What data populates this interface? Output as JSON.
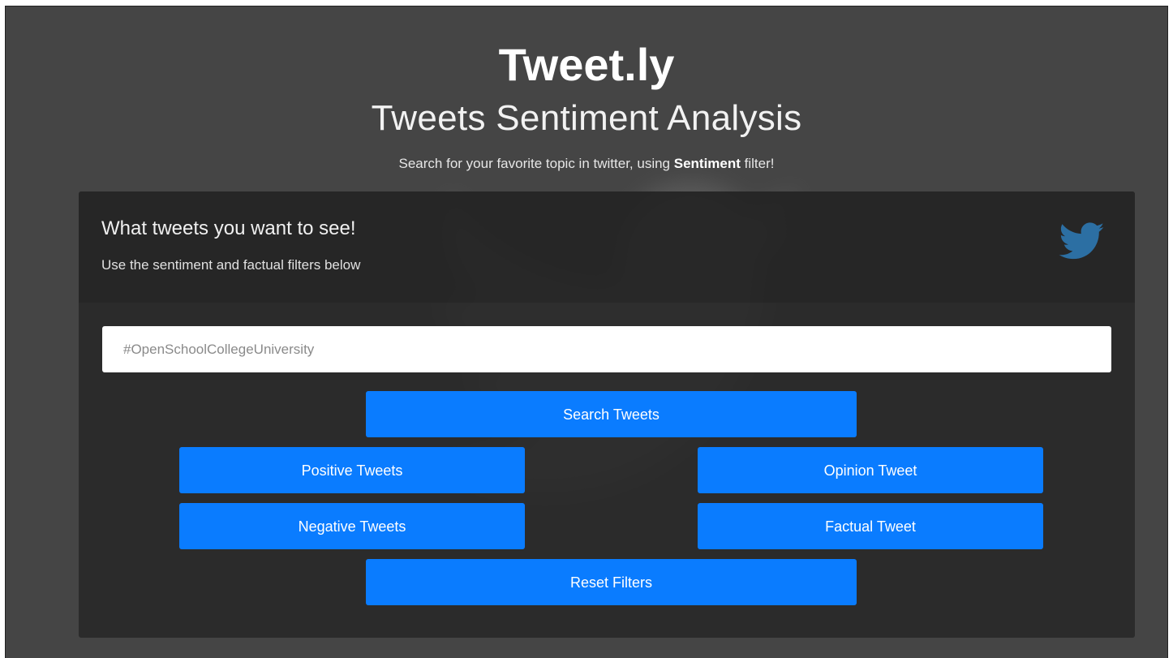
{
  "header": {
    "title": "Tweet.ly",
    "subtitle": "Tweets Sentiment Analysis",
    "tagline_prefix": "Search for your favorite topic in twitter, using ",
    "tagline_bold": "Sentiment",
    "tagline_suffix": " filter!"
  },
  "panel": {
    "title": "What tweets you want to see!",
    "description": "Use the sentiment and factual filters below",
    "icon": "twitter-bird-icon"
  },
  "search": {
    "value": "",
    "placeholder": "#OpenSchoolCollegeUniversity"
  },
  "buttons": {
    "search": "Search Tweets",
    "positive": "Positive Tweets",
    "opinion": "Opinion Tweet",
    "negative": "Negative Tweets",
    "factual": "Factual Tweet",
    "reset": "Reset Filters"
  },
  "colors": {
    "background": "#454545",
    "panel": "#2b2b2b",
    "accent": "#0a7cff",
    "twitter_icon": "#2c6fa3"
  }
}
